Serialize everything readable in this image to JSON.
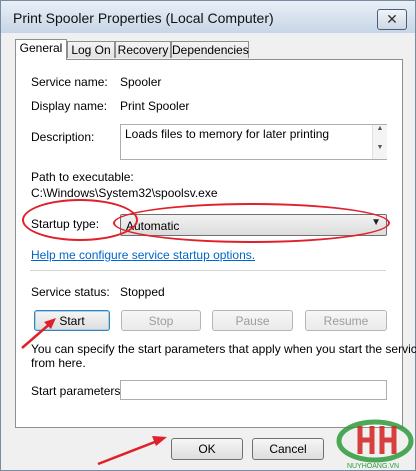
{
  "window": {
    "title": "Print Spooler Properties (Local Computer)",
    "close_glyph": "✕"
  },
  "tabs": [
    "General",
    "Log On",
    "Recovery",
    "Dependencies"
  ],
  "general": {
    "service_name_label": "Service name:",
    "service_name": "Spooler",
    "display_name_label": "Display name:",
    "display_name": "Print Spooler",
    "description_label": "Description:",
    "description": "Loads files to memory for later printing",
    "path_label": "Path to executable:",
    "path": "C:\\Windows\\System32\\spoolsv.exe",
    "startup_type_label": "Startup type:",
    "startup_type": "Automatic",
    "help_link": "Help me configure service startup options.",
    "service_status_label": "Service status:",
    "service_status": "Stopped",
    "buttons": {
      "start": "Start",
      "stop": "Stop",
      "pause": "Pause",
      "resume": "Resume"
    },
    "info_text_line1": "You can specify the start parameters that apply when you start the service",
    "info_text_line2": "from here.",
    "start_params_label": "Start parameters:",
    "start_params_value": ""
  },
  "footer": {
    "ok": "OK",
    "cancel": "Cancel"
  },
  "watermark": {
    "text": "NUYHOANG.VN"
  },
  "colors": {
    "annotation": "#e0202a",
    "link": "#0066cc",
    "watermark_green": "#2e9a3a"
  }
}
